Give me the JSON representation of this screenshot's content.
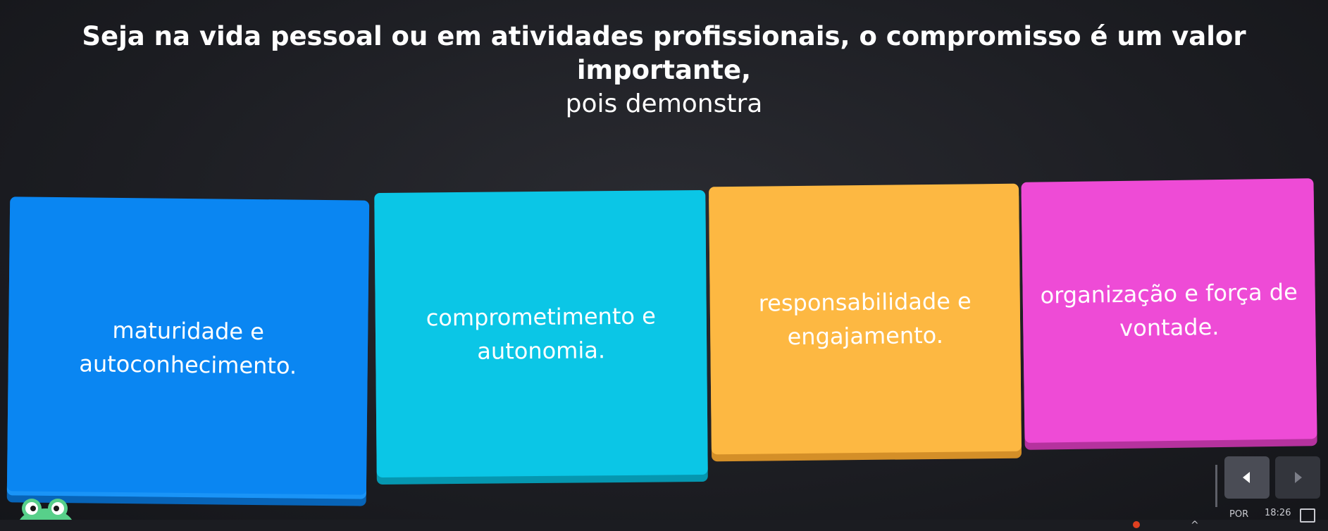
{
  "question": {
    "line1": "Seja na vida pessoal ou em atividades profissionais, o compromisso é um valor importante,",
    "line2": "pois demonstra"
  },
  "answers": [
    {
      "line1": "maturidade e",
      "line2": "autoconhecimento.",
      "color": "#0a86f2"
    },
    {
      "line1": "comprometimento e",
      "line2": "autonomia.",
      "color": "#0bc6e6"
    },
    {
      "line1": "responsabilidade e",
      "line2": "engajamento.",
      "color": "#fdb842"
    },
    {
      "line1": "organização e força de",
      "line2": "vontade.",
      "color": "#ee4bd6"
    }
  ],
  "navigation": {
    "prev_icon": "chevron-left-icon",
    "next_icon": "chevron-right-icon"
  },
  "taskbar": {
    "language": "POR",
    "time": "18:26"
  }
}
